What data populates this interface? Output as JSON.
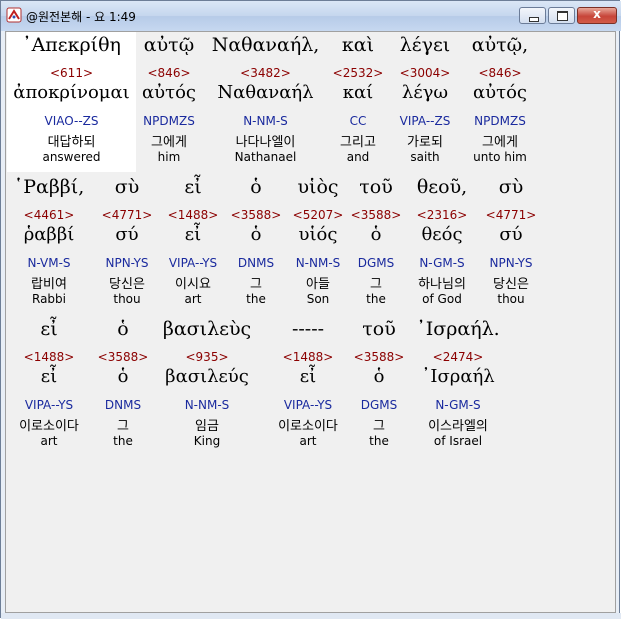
{
  "window": {
    "title": "@원전본해 - 요 1:49",
    "min_label": "",
    "max_label": "",
    "close_label": "x"
  },
  "rows": [
    {
      "words": [
        {
          "greek": "᾿Απεκρίθη",
          "strongs": "<611>",
          "lexeme": "ἀποκρίνομαι",
          "parsing": "VIAO--ZS",
          "korean": "대답하되",
          "english": "answered"
        },
        {
          "greek": "αὐτῷ",
          "strongs": "<846>",
          "lexeme": "αὐτός",
          "parsing": "NPDMZS",
          "korean": "그에게",
          "english": "him"
        },
        {
          "greek": "Ναθαναήλ,",
          "strongs": "<3482>",
          "lexeme": "Ναθαναήλ",
          "parsing": "N-NM-S",
          "korean": "나다나엘이",
          "english": "Nathanael"
        },
        {
          "greek": "καὶ",
          "strongs": "<2532>",
          "lexeme": "καί",
          "parsing": "CC",
          "korean": "그리고",
          "english": "and"
        },
        {
          "greek": "λέγει",
          "strongs": "<3004>",
          "lexeme": "λέγω",
          "parsing": "VIPA--ZS",
          "korean": "가로되",
          "english": "saith"
        },
        {
          "greek": "αὐτῷ,",
          "strongs": "<846>",
          "lexeme": "αὐτός",
          "parsing": "NPDMZS",
          "korean": "그에게",
          "english": "unto him"
        }
      ]
    },
    {
      "words": [
        {
          "greek": "῾Ραββί,",
          "strongs": "<4461>",
          "lexeme": "ῥαββί",
          "parsing": "N-VM-S",
          "korean": "랍비여",
          "english": "Rabbi"
        },
        {
          "greek": "σὺ",
          "strongs": "<4771>",
          "lexeme": "σύ",
          "parsing": "NPN-YS",
          "korean": "당신은",
          "english": "thou"
        },
        {
          "greek": "εἶ",
          "strongs": "<1488>",
          "lexeme": "εἶ",
          "parsing": "VIPA--YS",
          "korean": "이시요",
          "english": "art"
        },
        {
          "greek": "ὁ",
          "strongs": "<3588>",
          "lexeme": "ὁ",
          "parsing": "DNMS",
          "korean": "그",
          "english": "the"
        },
        {
          "greek": "υἱὸς",
          "strongs": "<5207>",
          "lexeme": "υἱός",
          "parsing": "N-NM-S",
          "korean": "아들",
          "english": "Son"
        },
        {
          "greek": "τοῦ",
          "strongs": "<3588>",
          "lexeme": "ὁ",
          "parsing": "DGMS",
          "korean": "그",
          "english": "the"
        },
        {
          "greek": "θεοῦ,",
          "strongs": "<2316>",
          "lexeme": "θεός",
          "parsing": "N-GM-S",
          "korean": "하나님의",
          "english": "of God"
        },
        {
          "greek": "σὺ",
          "strongs": "<4771>",
          "lexeme": "σύ",
          "parsing": "NPN-YS",
          "korean": "당신은",
          "english": "thou"
        }
      ]
    },
    {
      "words": [
        {
          "greek": "εἶ",
          "strongs": "<1488>",
          "lexeme": "εἶ",
          "parsing": "VIPA--YS",
          "korean": "이로소이다",
          "english": "art"
        },
        {
          "greek": "ὁ",
          "strongs": "<3588>",
          "lexeme": "ὁ",
          "parsing": "DNMS",
          "korean": "그",
          "english": "the"
        },
        {
          "greek": "βασιλεὺς",
          "strongs": "<935>",
          "lexeme": "βασιλεύς",
          "parsing": "N-NM-S",
          "korean": "임금",
          "english": "King"
        },
        {
          "greek": "-----",
          "strongs": "<1488>",
          "lexeme": "εἶ",
          "parsing": "VIPA--YS",
          "korean": "이로소이다",
          "english": "art"
        },
        {
          "greek": "τοῦ",
          "strongs": "<3588>",
          "lexeme": "ὁ",
          "parsing": "DGMS",
          "korean": "그",
          "english": "the"
        },
        {
          "greek": "᾿Ισραήλ.",
          "strongs": "<2474>",
          "lexeme": "᾿Ισραήλ",
          "parsing": "N-GM-S",
          "korean": "이스라엘의",
          "english": "of Israel"
        }
      ]
    }
  ]
}
